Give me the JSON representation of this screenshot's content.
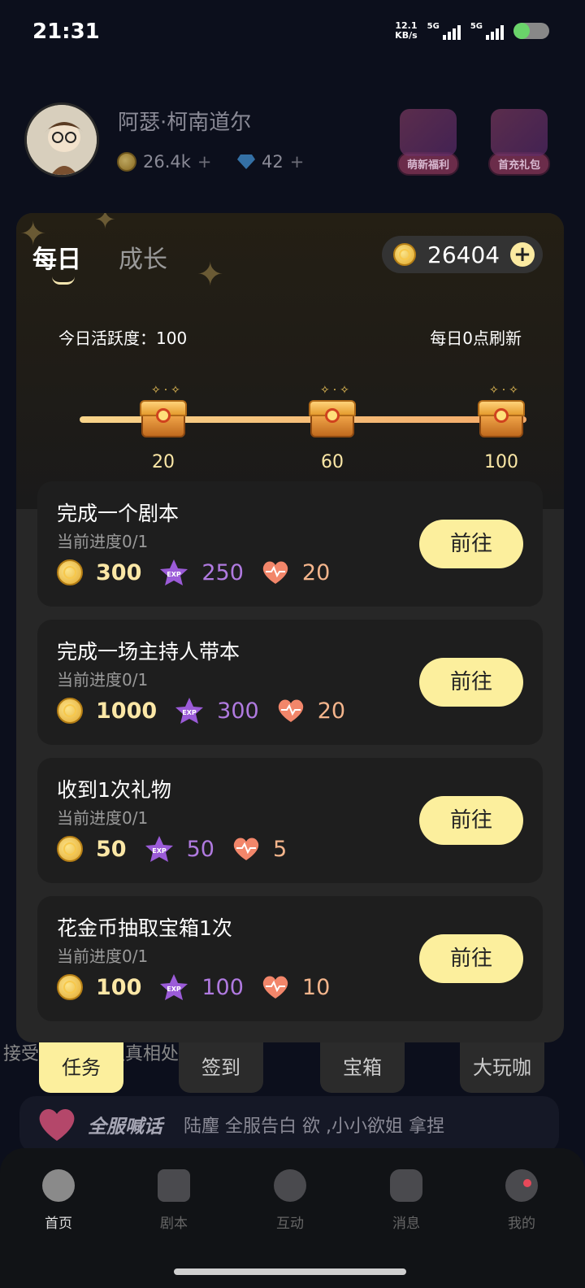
{
  "status_bar": {
    "time": "21:31",
    "net_speed_value": "12.1",
    "net_speed_unit": "KB/s",
    "sim1": "5G",
    "sim2": "5G",
    "battery_level": 0.45
  },
  "profile": {
    "username": "阿瑟·柯南道尔",
    "coins": "26.4k",
    "gems": "42",
    "plus": "+",
    "promo1": "萌新福利",
    "promo2": "首充礼包"
  },
  "panel": {
    "tab_daily": "每日",
    "tab_growth": "成长",
    "coin_balance": "26404",
    "add": "+",
    "activity": "今日活跃度：100",
    "refresh": "每日0点刷新",
    "milestones": [
      "20",
      "60",
      "100"
    ],
    "go_label": "前往"
  },
  "tasks": [
    {
      "title": "完成一个剧本",
      "progress": "当前进度0/1",
      "coins": "300",
      "exp": "250",
      "heart": "20"
    },
    {
      "title": "完成一场主持人带本",
      "progress": "当前进度0/1",
      "coins": "1000",
      "exp": "300",
      "heart": "20"
    },
    {
      "title": "收到1次礼物",
      "progress": "当前进度0/1",
      "coins": "50",
      "exp": "50",
      "heart": "5"
    },
    {
      "title": "花金币抽取宝箱1次",
      "progress": "当前进度0/1",
      "coins": "100",
      "exp": "100",
      "heart": "10"
    }
  ],
  "bottom_tabs": [
    "任务",
    "签到",
    "宝箱",
    "大玩咖"
  ],
  "background_text": "接受 女cp， 认真相处 者请私信",
  "broadcast": {
    "title": "全服喊话",
    "message": "陆麈 全服告白 欲 ,小小欲姐 拿捏"
  },
  "navbar": [
    "首页",
    "剧本",
    "互动",
    "消息",
    "我的"
  ],
  "colors": {
    "accent_yellow": "#fcef9d",
    "exp_purple": "#b07ae0",
    "heart_orange": "#f4b58c",
    "panel_bg": "#272727"
  }
}
